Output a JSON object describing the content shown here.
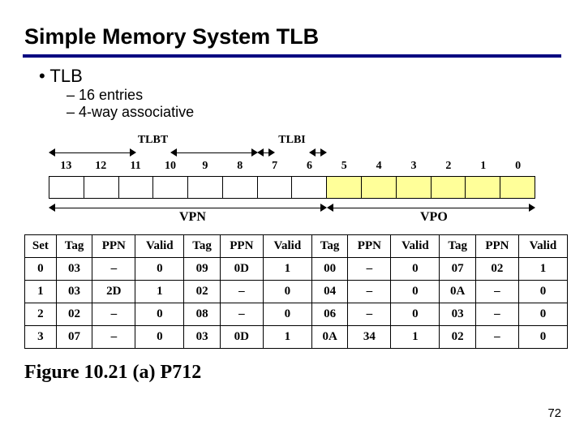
{
  "title": "Simple Memory System TLB",
  "bullets": {
    "lvl1": "TLB",
    "lvl2a": "16 entries",
    "lvl2b": "4-way associative"
  },
  "bits": {
    "tlbt_label": "TLBT",
    "tlbi_label": "TLBI",
    "vpn_label": "VPN",
    "vpo_label": "VPO",
    "nums": [
      "13",
      "12",
      "11",
      "10",
      "9",
      "8",
      "7",
      "6",
      "5",
      "4",
      "3",
      "2",
      "1",
      "0"
    ]
  },
  "table": {
    "headers": [
      "Set",
      "Tag",
      "PPN",
      "Valid",
      "Tag",
      "PPN",
      "Valid",
      "Tag",
      "PPN",
      "Valid",
      "Tag",
      "PPN",
      "Valid"
    ],
    "rows": [
      [
        "0",
        "03",
        "–",
        "0",
        "09",
        "0D",
        "1",
        "00",
        "–",
        "0",
        "07",
        "02",
        "1"
      ],
      [
        "1",
        "03",
        "2D",
        "1",
        "02",
        "–",
        "0",
        "04",
        "–",
        "0",
        "0A",
        "–",
        "0"
      ],
      [
        "2",
        "02",
        "–",
        "0",
        "08",
        "–",
        "0",
        "06",
        "–",
        "0",
        "03",
        "–",
        "0"
      ],
      [
        "3",
        "07",
        "–",
        "0",
        "03",
        "0D",
        "1",
        "0A",
        "34",
        "1",
        "02",
        "–",
        "0"
      ]
    ]
  },
  "caption": "Figure 10.21 (a) P712",
  "pagenum": "72"
}
